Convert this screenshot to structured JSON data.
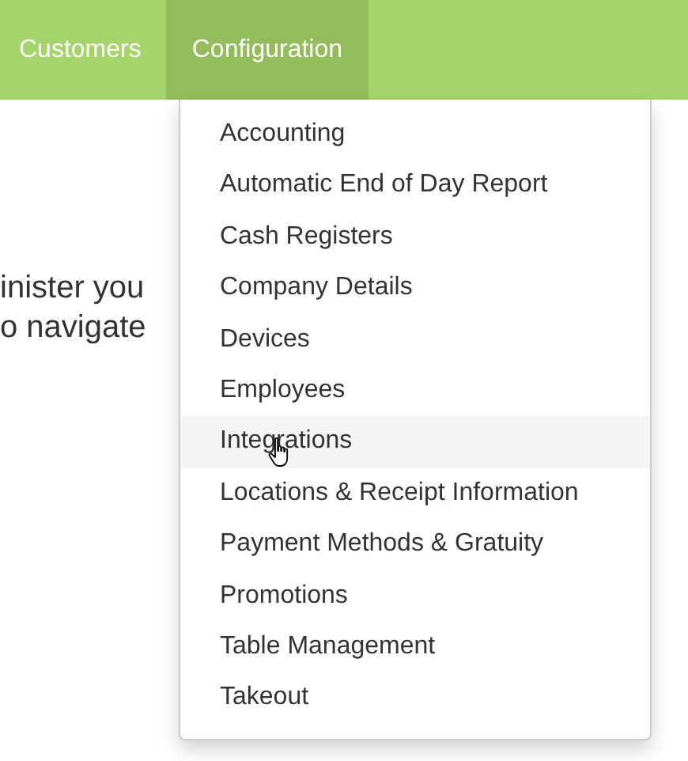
{
  "navbar": {
    "items": [
      {
        "label": "Customers",
        "selected": false
      },
      {
        "label": "Configuration",
        "selected": true
      }
    ]
  },
  "body_text": [
    "inister you",
    "o navigate"
  ],
  "dropdown": {
    "items": [
      {
        "label": "Accounting",
        "highlighted": false
      },
      {
        "label": "Automatic End of Day Report",
        "highlighted": false
      },
      {
        "label": "Cash Registers",
        "highlighted": false
      },
      {
        "label": "Company Details",
        "highlighted": false
      },
      {
        "label": "Devices",
        "highlighted": false
      },
      {
        "label": "Employees",
        "highlighted": false
      },
      {
        "label": "Integrations",
        "highlighted": true
      },
      {
        "label": "Locations & Receipt Information",
        "highlighted": false
      },
      {
        "label": "Payment Methods & Gratuity",
        "highlighted": false
      },
      {
        "label": "Promotions",
        "highlighted": false
      },
      {
        "label": "Table Management",
        "highlighted": false
      },
      {
        "label": "Takeout",
        "highlighted": false
      }
    ]
  }
}
